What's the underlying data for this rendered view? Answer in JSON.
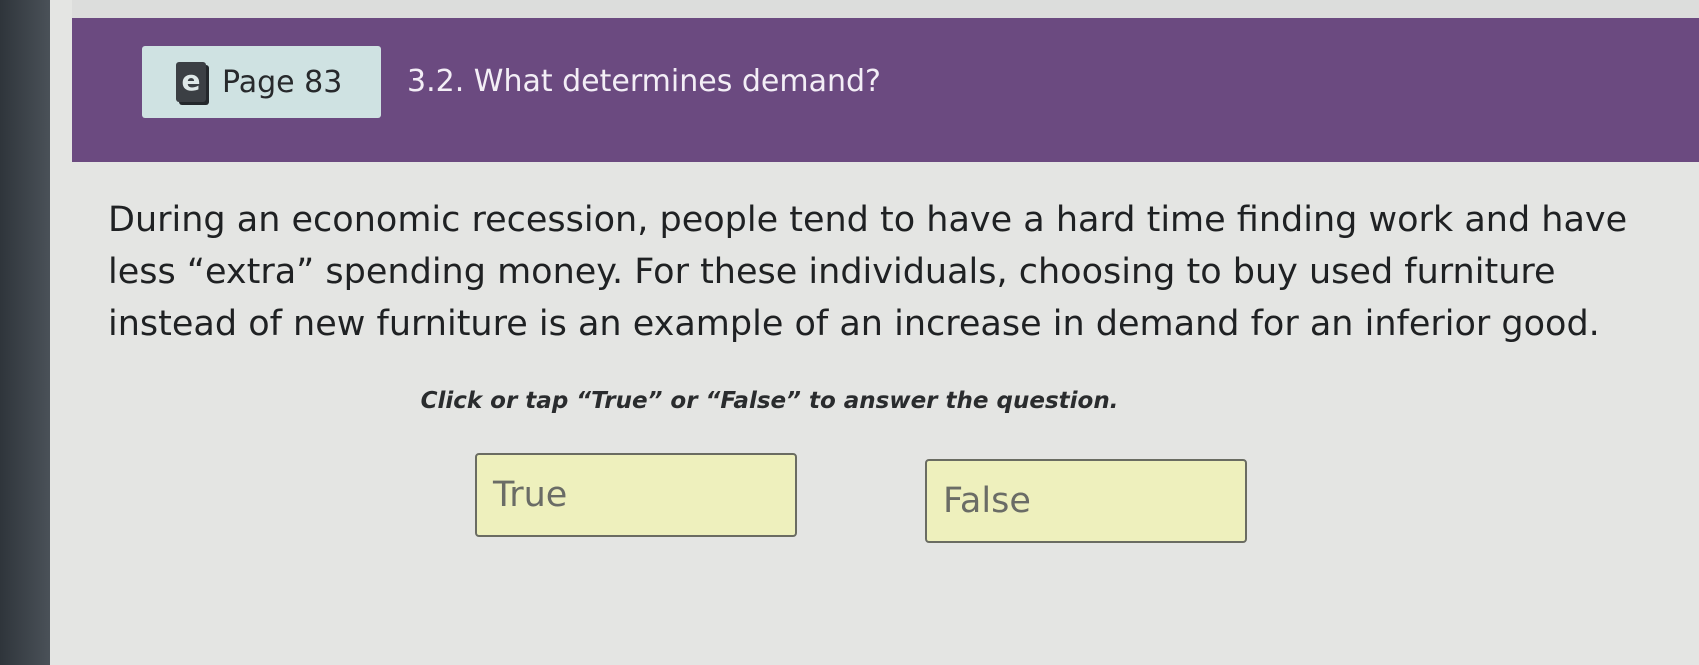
{
  "header": {
    "page_icon": "e",
    "page_label": "Page 83",
    "section_title": "3.2. What determines demand?"
  },
  "question": {
    "text": "During an economic recession, people tend to have a hard time finding work and have less “extra” spending money. For these individuals, choosing to buy used furniture instead of new furniture is an example of an increase in demand for an inferior good.",
    "instruction": "Click or tap “True” or “False” to answer the question."
  },
  "answers": {
    "true_label": "True",
    "false_label": "False"
  },
  "colors": {
    "header_bg": "#6b4a80",
    "badge_bg": "#cfe2e2",
    "answer_bg": "#eef0bd",
    "page_bg": "#e4e5e3"
  }
}
